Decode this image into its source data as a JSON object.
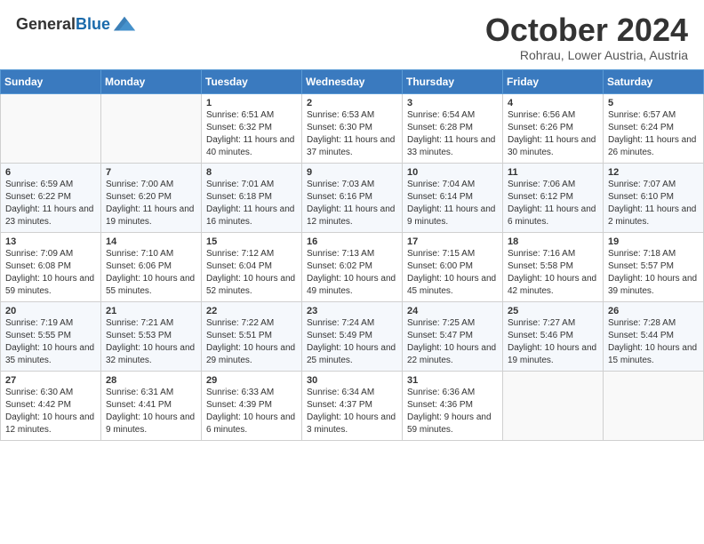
{
  "header": {
    "logo_general": "General",
    "logo_blue": "Blue",
    "month": "October 2024",
    "location": "Rohrau, Lower Austria, Austria"
  },
  "weekdays": [
    "Sunday",
    "Monday",
    "Tuesday",
    "Wednesday",
    "Thursday",
    "Friday",
    "Saturday"
  ],
  "weeks": [
    [
      {
        "day": "",
        "info": ""
      },
      {
        "day": "",
        "info": ""
      },
      {
        "day": "1",
        "info": "Sunrise: 6:51 AM\nSunset: 6:32 PM\nDaylight: 11 hours and 40 minutes."
      },
      {
        "day": "2",
        "info": "Sunrise: 6:53 AM\nSunset: 6:30 PM\nDaylight: 11 hours and 37 minutes."
      },
      {
        "day": "3",
        "info": "Sunrise: 6:54 AM\nSunset: 6:28 PM\nDaylight: 11 hours and 33 minutes."
      },
      {
        "day": "4",
        "info": "Sunrise: 6:56 AM\nSunset: 6:26 PM\nDaylight: 11 hours and 30 minutes."
      },
      {
        "day": "5",
        "info": "Sunrise: 6:57 AM\nSunset: 6:24 PM\nDaylight: 11 hours and 26 minutes."
      }
    ],
    [
      {
        "day": "6",
        "info": "Sunrise: 6:59 AM\nSunset: 6:22 PM\nDaylight: 11 hours and 23 minutes."
      },
      {
        "day": "7",
        "info": "Sunrise: 7:00 AM\nSunset: 6:20 PM\nDaylight: 11 hours and 19 minutes."
      },
      {
        "day": "8",
        "info": "Sunrise: 7:01 AM\nSunset: 6:18 PM\nDaylight: 11 hours and 16 minutes."
      },
      {
        "day": "9",
        "info": "Sunrise: 7:03 AM\nSunset: 6:16 PM\nDaylight: 11 hours and 12 minutes."
      },
      {
        "day": "10",
        "info": "Sunrise: 7:04 AM\nSunset: 6:14 PM\nDaylight: 11 hours and 9 minutes."
      },
      {
        "day": "11",
        "info": "Sunrise: 7:06 AM\nSunset: 6:12 PM\nDaylight: 11 hours and 6 minutes."
      },
      {
        "day": "12",
        "info": "Sunrise: 7:07 AM\nSunset: 6:10 PM\nDaylight: 11 hours and 2 minutes."
      }
    ],
    [
      {
        "day": "13",
        "info": "Sunrise: 7:09 AM\nSunset: 6:08 PM\nDaylight: 10 hours and 59 minutes."
      },
      {
        "day": "14",
        "info": "Sunrise: 7:10 AM\nSunset: 6:06 PM\nDaylight: 10 hours and 55 minutes."
      },
      {
        "day": "15",
        "info": "Sunrise: 7:12 AM\nSunset: 6:04 PM\nDaylight: 10 hours and 52 minutes."
      },
      {
        "day": "16",
        "info": "Sunrise: 7:13 AM\nSunset: 6:02 PM\nDaylight: 10 hours and 49 minutes."
      },
      {
        "day": "17",
        "info": "Sunrise: 7:15 AM\nSunset: 6:00 PM\nDaylight: 10 hours and 45 minutes."
      },
      {
        "day": "18",
        "info": "Sunrise: 7:16 AM\nSunset: 5:58 PM\nDaylight: 10 hours and 42 minutes."
      },
      {
        "day": "19",
        "info": "Sunrise: 7:18 AM\nSunset: 5:57 PM\nDaylight: 10 hours and 39 minutes."
      }
    ],
    [
      {
        "day": "20",
        "info": "Sunrise: 7:19 AM\nSunset: 5:55 PM\nDaylight: 10 hours and 35 minutes."
      },
      {
        "day": "21",
        "info": "Sunrise: 7:21 AM\nSunset: 5:53 PM\nDaylight: 10 hours and 32 minutes."
      },
      {
        "day": "22",
        "info": "Sunrise: 7:22 AM\nSunset: 5:51 PM\nDaylight: 10 hours and 29 minutes."
      },
      {
        "day": "23",
        "info": "Sunrise: 7:24 AM\nSunset: 5:49 PM\nDaylight: 10 hours and 25 minutes."
      },
      {
        "day": "24",
        "info": "Sunrise: 7:25 AM\nSunset: 5:47 PM\nDaylight: 10 hours and 22 minutes."
      },
      {
        "day": "25",
        "info": "Sunrise: 7:27 AM\nSunset: 5:46 PM\nDaylight: 10 hours and 19 minutes."
      },
      {
        "day": "26",
        "info": "Sunrise: 7:28 AM\nSunset: 5:44 PM\nDaylight: 10 hours and 15 minutes."
      }
    ],
    [
      {
        "day": "27",
        "info": "Sunrise: 6:30 AM\nSunset: 4:42 PM\nDaylight: 10 hours and 12 minutes."
      },
      {
        "day": "28",
        "info": "Sunrise: 6:31 AM\nSunset: 4:41 PM\nDaylight: 10 hours and 9 minutes."
      },
      {
        "day": "29",
        "info": "Sunrise: 6:33 AM\nSunset: 4:39 PM\nDaylight: 10 hours and 6 minutes."
      },
      {
        "day": "30",
        "info": "Sunrise: 6:34 AM\nSunset: 4:37 PM\nDaylight: 10 hours and 3 minutes."
      },
      {
        "day": "31",
        "info": "Sunrise: 6:36 AM\nSunset: 4:36 PM\nDaylight: 9 hours and 59 minutes."
      },
      {
        "day": "",
        "info": ""
      },
      {
        "day": "",
        "info": ""
      }
    ]
  ]
}
